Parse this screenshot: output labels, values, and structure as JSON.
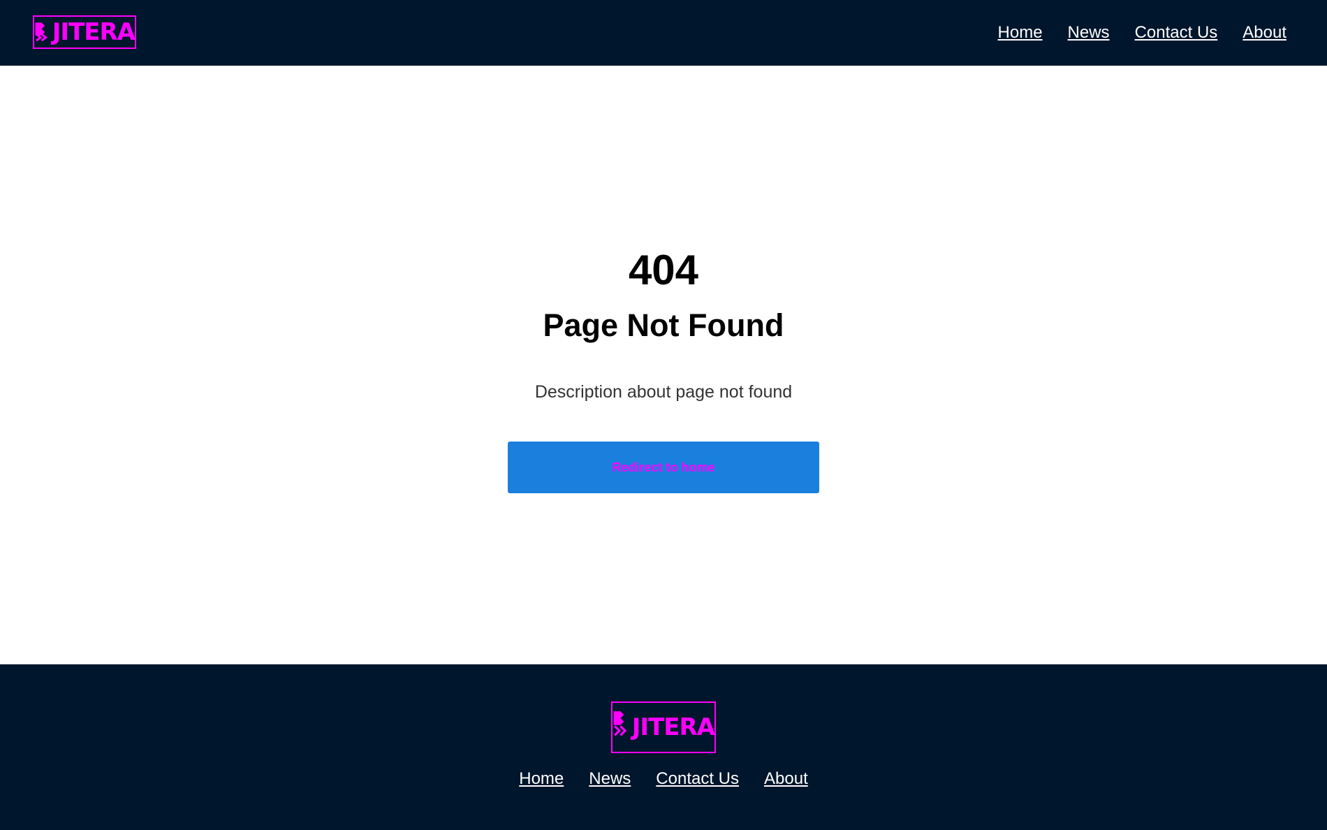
{
  "header": {
    "logo_text": "JITERA",
    "nav": [
      "Home",
      "News",
      "Contact Us",
      "About"
    ]
  },
  "main": {
    "code": "404",
    "title": "Page Not Found",
    "description": "Description about page not found",
    "button_label": "Redirect to home"
  },
  "footer": {
    "logo_text": "JITERA",
    "nav": [
      "Home",
      "News",
      "Contact Us",
      "About"
    ]
  },
  "colors": {
    "header_bg": "#00162c",
    "accent": "#ff00ff",
    "button_bg": "#1b7fde"
  }
}
